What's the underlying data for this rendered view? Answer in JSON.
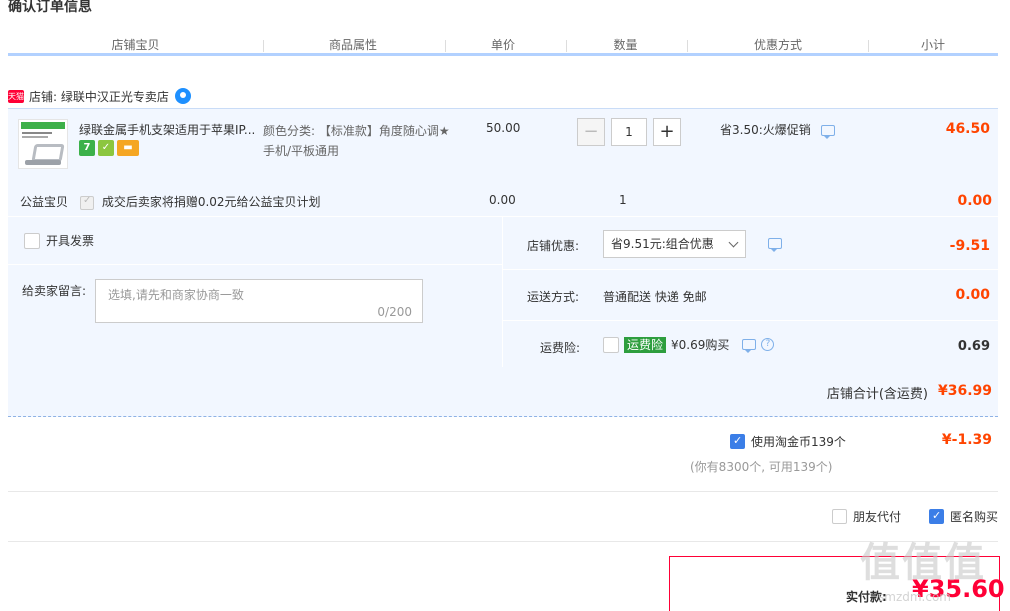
{
  "page": {
    "title": "确认订单信息"
  },
  "header": {
    "columns": [
      "店铺宝贝",
      "商品属性",
      "单价",
      "数量",
      "优惠方式",
      "小计"
    ]
  },
  "shop": {
    "badge": "天猫",
    "name": "店铺: 绿联中汉正光专卖店"
  },
  "item": {
    "title": "绿联金属手机支架适用于苹果IP...",
    "attr_label": "颜色分类: 【标准款】角度随心调★手机/平板通用",
    "price": "50.00",
    "qty": "1",
    "qty_minus": "−",
    "qty_plus": "+",
    "promo": "省3.50:火爆促销",
    "subtotal": "46.50",
    "badges": [
      "7",
      "✓",
      "▬"
    ]
  },
  "charity": {
    "label": "公益宝贝",
    "text": "成交后卖家将捐赠0.02元给公益宝贝计划",
    "price": "0.00",
    "qty": "1",
    "subtotal": "0.00"
  },
  "invoice": {
    "label": "开具发票"
  },
  "message": {
    "label": "给卖家留言:",
    "placeholder": "选填,请先和商家协商一致",
    "count": "0/200"
  },
  "shop_discount": {
    "label": "店铺优惠:",
    "selected": "省9.51元:组合优惠",
    "amount": "-9.51"
  },
  "shipping": {
    "label": "运送方式:",
    "value": "普通配送 快递 免邮",
    "amount": "0.00"
  },
  "insurance": {
    "label": "运费险:",
    "tag": "运费险",
    "text": "¥0.69购买",
    "amount": "0.69"
  },
  "shop_total": {
    "label": "店铺合计(含运费)",
    "value": "¥36.99"
  },
  "coins": {
    "label": "使用淘金币139个",
    "amount": "¥-1.39",
    "note": "(你有8300个, 可用139个)"
  },
  "options": {
    "friend_pay": "朋友代付",
    "anonymous": "匿名购买"
  },
  "payment": {
    "label": "实付款:",
    "amount": "¥35.60"
  },
  "watermark": {
    "text": "值值值",
    "url": "smzdm.com"
  },
  "colors": {
    "accent": "#ff0036",
    "price": "#ff4400",
    "highlight_bg": "#f2f7ff",
    "checkbox": "#3b7ee7"
  }
}
